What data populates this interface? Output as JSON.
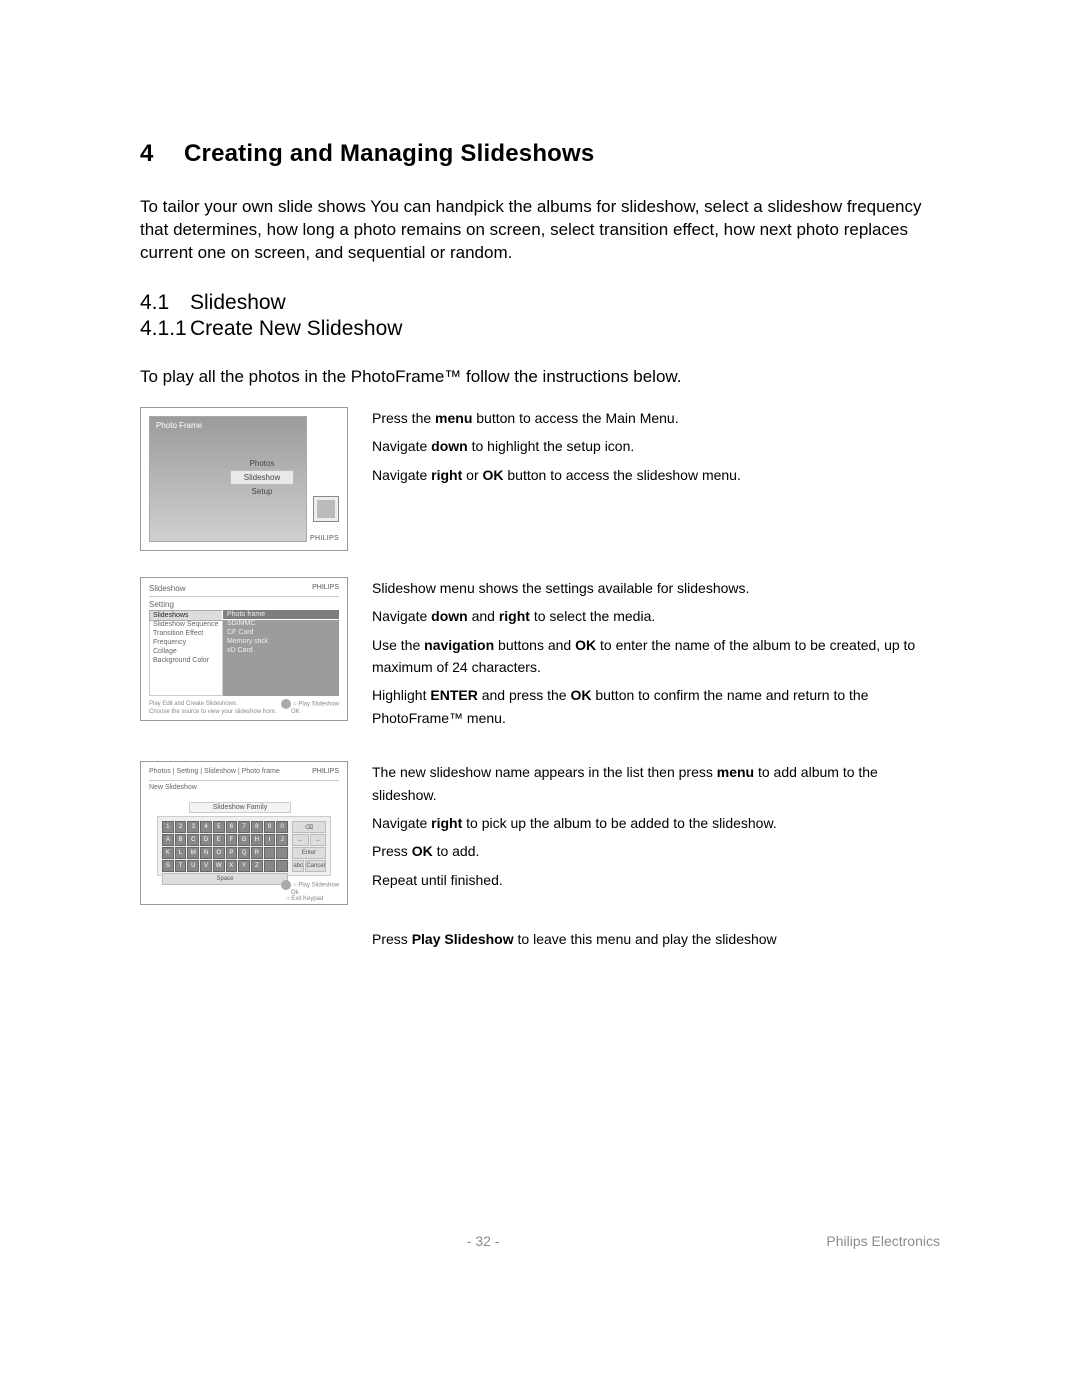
{
  "chapter": {
    "num": "4",
    "title": "Creating and Managing Slideshows"
  },
  "intro": "To tailor your own slide shows You can handpick the albums for slideshow,  select a slideshow frequency that determines, how long a photo remains on screen, select transition effect,  how next photo replaces current one on screen, and sequential or random.",
  "sub": {
    "num": "4.1",
    "title": "Slideshow"
  },
  "subsub": {
    "num": "4.1.1",
    "title": "Create New Slideshow"
  },
  "lead": "To play all the photos in the PhotoFrame™ follow the instructions below.",
  "brand": "PHILIPS",
  "shot1": {
    "title": "Photo Frame",
    "menu": [
      "Photos",
      "Slideshow",
      "Setup"
    ]
  },
  "steps1": {
    "a_pre": "Press the ",
    "a_b": "menu",
    "a_post": " button to access the Main Menu.",
    "b_pre": "Navigate ",
    "b_b": "down",
    "b_post": " to highlight the setup icon.",
    "c_pre": "Navigate ",
    "c_b1": "right",
    "c_mid": " or ",
    "c_b2": "OK",
    "c_post": " button to access the slideshow menu."
  },
  "shot2": {
    "bar": "Slideshow",
    "section": "Setting",
    "left": [
      "Slideshows",
      "Slideshow Sequence",
      "Transition Effect",
      "Frequency",
      "Collage",
      "Background Color"
    ],
    "right": [
      "Photo frame",
      "SD/MMC",
      "CF Card",
      "Memory stick",
      "xD Card"
    ],
    "foot1": "Play Edit and Create Slideshows.",
    "foot2": "Choose the source to view your slideshow from.",
    "actionA": "Play Slideshow",
    "actionB": "OK"
  },
  "steps2": {
    "a": "Slideshow menu shows the settings available for slideshows.",
    "b_pre": "Navigate ",
    "b_b1": "down",
    "b_mid": " and ",
    "b_b2": "right",
    "b_post": " to select the media.",
    "c_pre": "Use the ",
    "c_b1": "navigation",
    "c_mid": " buttons and ",
    "c_b2": "OK",
    "c_post": " to enter the name of the album to be created, up to maximum of 24 characters.",
    "d_pre": "Highlight ",
    "d_b1": "ENTER",
    "d_mid": " and press the ",
    "d_b2": "OK",
    "d_post": " button to confirm the name and return to the PhotoFrame™ menu."
  },
  "shot3": {
    "crumb": "Photos | Setting | Slideshow | Photo frame",
    "ns": "New Slideshow",
    "field": "Slideshow Family",
    "rows": [
      [
        "1",
        "2",
        "3",
        "4",
        "5",
        "6",
        "7",
        "8",
        "9",
        "0"
      ],
      [
        "A",
        "B",
        "C",
        "D",
        "E",
        "F",
        "G",
        "H",
        "I",
        "J"
      ],
      [
        "K",
        "L",
        "M",
        "N",
        "O",
        "P",
        "Q",
        "R",
        " ",
        " "
      ],
      [
        "S",
        "T",
        "U",
        "V",
        "W",
        "X",
        "Y",
        "Z",
        " ",
        " "
      ]
    ],
    "space": "Space",
    "side": {
      "bksp": "⌫",
      "left": "←",
      "right": "→",
      "enter": "Enter",
      "abc": "abc",
      "cancel": "Cancel"
    },
    "actionA": "Play Slideshow",
    "actionB": "Ok",
    "actionC": "Exit Keypad"
  },
  "steps3": {
    "a_pre": "The new slideshow name appears in the list then press ",
    "a_b": "menu",
    "a_post": " to add album to the slideshow.",
    "b_pre": "Navigate ",
    "b_b": "right",
    "b_post": " to pick up the album to be added to the slideshow.",
    "c_pre": "Press ",
    "c_b": "OK",
    "c_post": " to add.",
    "d": "Repeat until finished."
  },
  "final": {
    "pre": "Press ",
    "b": "Play Slideshow",
    "post": " to leave this menu and play the slideshow"
  },
  "footer": {
    "page": "- 32 -",
    "co": "Philips Electronics"
  }
}
